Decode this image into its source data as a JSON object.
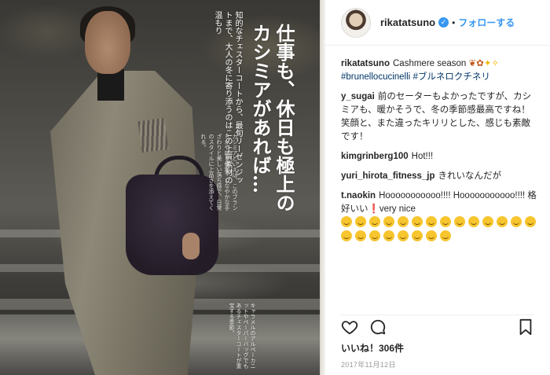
{
  "post": {
    "photo_alt": "magazine-page",
    "magazine": {
      "headline": "仕事も、休日も極上のカシミアがあれば…",
      "lead": "知的なチェスターコートから、最旬リーゼンジットまで、大人の冬に寄り添うのはこの上質素材の温もり",
      "body": "カシミアといえば、このブランドがやはり格別。しなやかな手ざわりと美しい落ち感で、日常のスタイルに上品さを添えてくれる。",
      "sub": "キャラメルのアルペーカニットやペーパーバッグでもあるチェスターコートが重宝する季節。"
    }
  },
  "header": {
    "username": "rikatatsuno",
    "verified_symbol": "✓",
    "separator": "•",
    "follow_label": "フォローする"
  },
  "caption": {
    "user": "rikatatsuno",
    "text": "Cashmere season",
    "hashtag1": "#brunellocucinelli",
    "hashtag2": "#ブルネロクチネリ"
  },
  "comments": [
    {
      "user": "y_sugai",
      "text": "前のセーターもよかったですが、カシミアも、暖かそうで、冬の季節感最高ですね！笑顔と、また違ったキリリとした、感じも素敵です！"
    },
    {
      "user": "kimgrinberg100",
      "text": "Hot!!!"
    },
    {
      "user": "yuri_hirota_fitness_jp",
      "text": "きれいなんだが"
    },
    {
      "user": "t.naokin",
      "text": "Hooooooooooo!!!! Hooooooooooo!!!! 格好いい",
      "text2": "very nice"
    }
  ],
  "actions": {
    "like_icon": "heart-icon",
    "comment_icon": "comment-bubble-icon",
    "save_icon": "bookmark-icon"
  },
  "likes": "いいね！306件",
  "date": "2017年11月12日",
  "colors": {
    "accent": "#3897f0",
    "text": "#262626",
    "muted": "#999999"
  }
}
